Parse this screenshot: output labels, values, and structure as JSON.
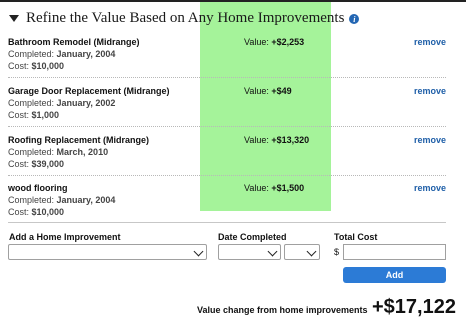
{
  "section": {
    "title": "Refine the Value Based on Any Home Improvements"
  },
  "improvements": [
    {
      "name": "Bathroom Remodel (Midrange)",
      "completed_label": "Completed:",
      "completed": "January, 2004",
      "cost_label": "Cost:",
      "cost": "$10,000",
      "value_label": "Value:",
      "value": "+$2,253",
      "remove": "remove"
    },
    {
      "name": "Garage Door Replacement (Midrange)",
      "completed_label": "Completed:",
      "completed": "January, 2002",
      "cost_label": "Cost:",
      "cost": "$1,000",
      "value_label": "Value:",
      "value": "+$49",
      "remove": "remove"
    },
    {
      "name": "Roofing Replacement (Midrange)",
      "completed_label": "Completed:",
      "completed": "March, 2010",
      "cost_label": "Cost:",
      "cost": "$39,000",
      "value_label": "Value:",
      "value": "+$13,320",
      "remove": "remove"
    },
    {
      "name": "wood flooring",
      "completed_label": "Completed:",
      "completed": "January, 2004",
      "cost_label": "Cost:",
      "cost": "$10,000",
      "value_label": "Value:",
      "value": "+$1,500",
      "remove": "remove"
    }
  ],
  "add_form": {
    "improvement_label": "Add a Home Improvement",
    "date_label": "Date Completed",
    "cost_label": "Total Cost",
    "currency": "$",
    "add_button": "Add"
  },
  "summary": {
    "label": "Value change from home improvements",
    "value": "+$17,122"
  },
  "colors": {
    "highlight": "#a5f39a",
    "link": "#1f5fa8",
    "button": "#2c7bd6"
  }
}
